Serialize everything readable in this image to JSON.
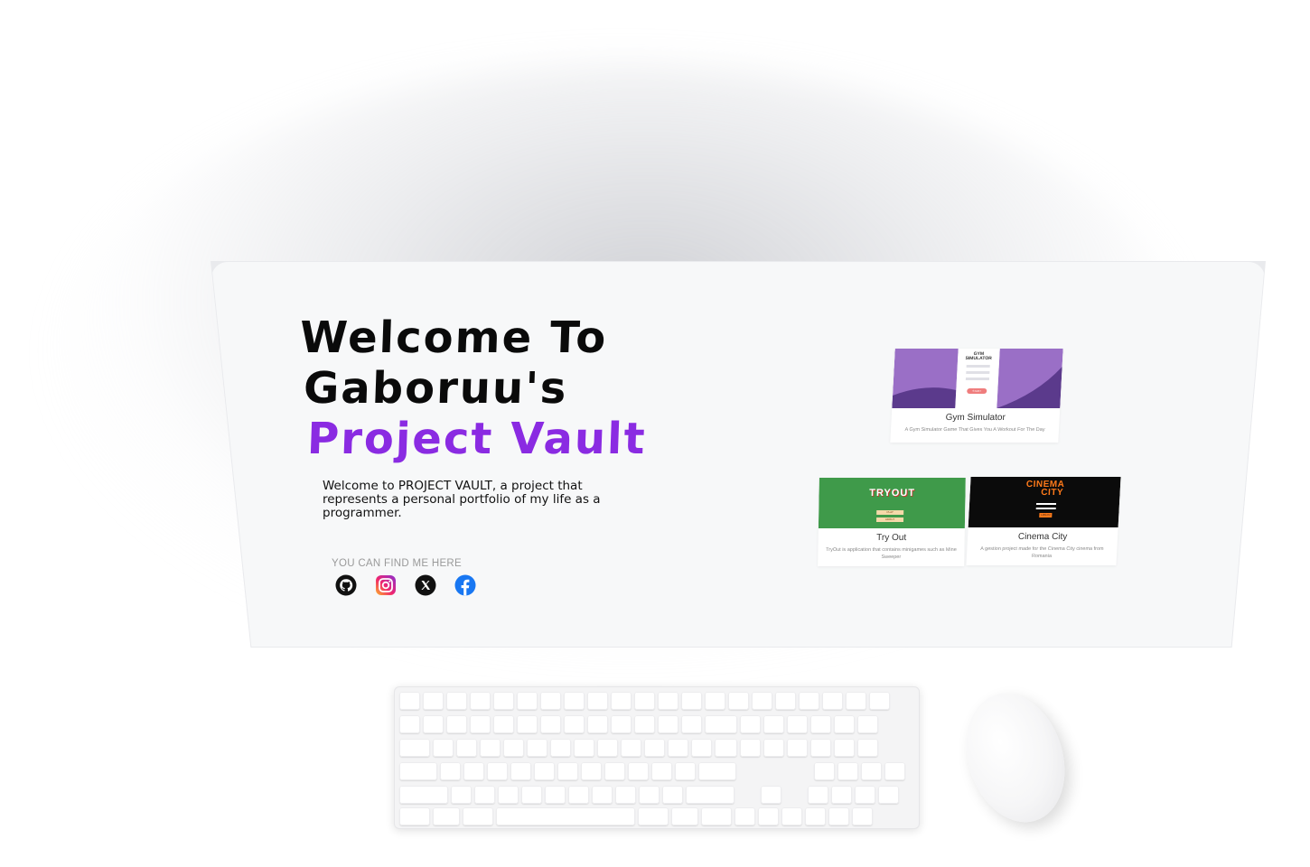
{
  "hero": {
    "title_line1": "Welcome To",
    "title_line2": "Gaboruu's",
    "title_line3": "Project Vault",
    "accent_color": "#8a2be2",
    "intro": "Welcome to PROJECT VAULT, a project that represents a personal portfolio of my life as a programmer."
  },
  "socials": {
    "caption": "YOU CAN FIND ME HERE",
    "items": [
      {
        "name": "github",
        "icon": "github-icon"
      },
      {
        "name": "instagram",
        "icon": "instagram-icon"
      },
      {
        "name": "x",
        "icon": "x-icon"
      },
      {
        "name": "facebook",
        "icon": "facebook-icon"
      }
    ]
  },
  "projects": [
    {
      "title": "Gym Simulator",
      "description": "A Gym Simulator Game That Gives You A Workout For The Day",
      "thumb_logo": "GYM SIMULATOR",
      "thumb_button": "START"
    },
    {
      "title": "Try Out",
      "description": "TryOut is application that contains minigames such as Mine Sweeper",
      "thumb_logo": "TRYOUT",
      "thumb_button_1": "PLAY",
      "thumb_button_2": "ABOUT"
    },
    {
      "title": "Cinema City",
      "description": "A gestion project made for the Cinema City cinema from Romania",
      "thumb_logo_1": "CINEMA",
      "thumb_logo_2": "CITY",
      "thumb_button": "LOG IN"
    }
  ],
  "colors": {
    "gym_thumb": "#9a6fc6",
    "tryout_thumb": "#3f9a4a",
    "cinema_thumb": "#0b0b0b",
    "cinema_logo": "#ff7a1a"
  }
}
